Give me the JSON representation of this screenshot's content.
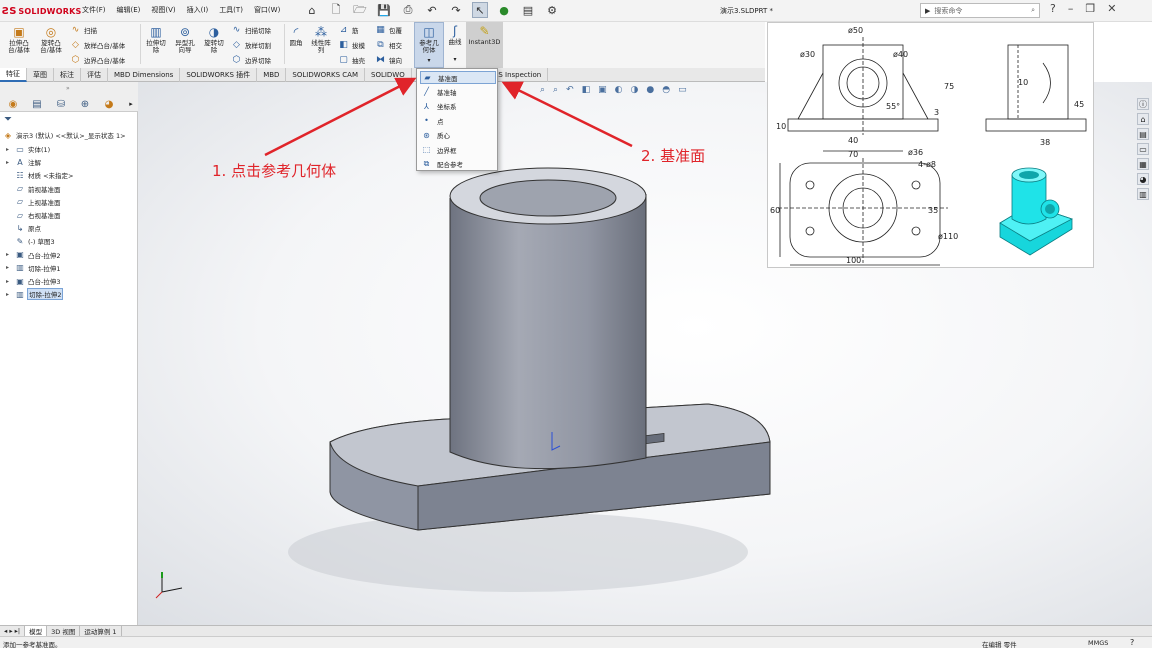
{
  "app": {
    "logo_text": "SOLIDWORKS",
    "document_title": "演示3.SLDPRT *"
  },
  "menu": [
    "文件(F)",
    "编辑(E)",
    "视图(V)",
    "插入(I)",
    "工具(T)",
    "窗口(W)"
  ],
  "search": {
    "placeholder": "搜索命令"
  },
  "ribbon": {
    "extrude_boss": "拉伸凸\n台/基体",
    "revolve_boss": "旋转凸\n台/基体",
    "sweep": "扫描",
    "loft_boss": "放样凸台/基体",
    "boundary_boss": "边界凸台/基体",
    "extrude_cut": "拉伸切\n除",
    "hole_wizard": "异型孔\n向导",
    "revolve_cut": "旋转切\n除",
    "swept_cut": "扫描切除",
    "lofted_cut": "放样切割",
    "boundary_cut": "边界切除",
    "fillet": "圆角",
    "linear_pattern": "线性阵\n列",
    "rib": "筋",
    "draft": "拔模",
    "shell": "抽壳",
    "wrap": "包覆",
    "intersect": "相交",
    "mirror": "镜向",
    "reference_geometry": "参考几\n何体",
    "curves": "曲线",
    "instant3d": "Instant3D"
  },
  "tabs": [
    "特征",
    "草图",
    "标注",
    "评估",
    "MBD Dimensions",
    "SOLIDWORKS 插件",
    "MBD",
    "SOLIDWORKS CAM",
    "SOLIDWO",
    "KS Inspection"
  ],
  "feature_tree": {
    "root": "演示3 (默认) <<默认>_显示状态 1>",
    "items": [
      {
        "label": "实体(1)",
        "icon": "folder-icon",
        "arrow": "▸"
      },
      {
        "label": "注解",
        "icon": "annotation-icon",
        "arrow": "▸"
      },
      {
        "label": "材质 <未指定>",
        "icon": "material-icon",
        "arrow": ""
      },
      {
        "label": "前视基准面",
        "icon": "plane-icon",
        "arrow": ""
      },
      {
        "label": "上视基准面",
        "icon": "plane-icon",
        "arrow": ""
      },
      {
        "label": "右视基准面",
        "icon": "plane-icon",
        "arrow": ""
      },
      {
        "label": "原点",
        "icon": "origin-icon",
        "arrow": ""
      },
      {
        "label": "(-) 草图3",
        "icon": "sketch-icon",
        "arrow": ""
      },
      {
        "label": "凸台-拉伸2",
        "icon": "boss-extrude-icon",
        "arrow": "▸"
      },
      {
        "label": "切除-拉伸1",
        "icon": "cut-extrude-icon",
        "arrow": "▸"
      },
      {
        "label": "凸台-拉伸3",
        "icon": "boss-extrude-icon",
        "arrow": "▸"
      },
      {
        "label": "切除-拉伸2",
        "icon": "cut-extrude-icon",
        "arrow": "▸"
      }
    ]
  },
  "dropdown": {
    "items": [
      {
        "label": "基准面",
        "icon": "plane-icon"
      },
      {
        "label": "基准轴",
        "icon": "axis-icon"
      },
      {
        "label": "坐标系",
        "icon": "coordinate-system-icon"
      },
      {
        "label": "点",
        "icon": "point-icon"
      },
      {
        "label": "质心",
        "icon": "center-of-mass-icon"
      },
      {
        "label": "边界框",
        "icon": "bounding-box-icon"
      },
      {
        "label": "配合参考",
        "icon": "mate-reference-icon"
      }
    ]
  },
  "annotations": {
    "step1": "1. 点击参考几何体",
    "step2": "2. 基准面"
  },
  "drawing": {
    "dims": [
      "ø50",
      "ø30",
      "ø40",
      "75",
      "3",
      "55°",
      "10",
      "40",
      "10",
      "45",
      "38",
      "70",
      "ø36",
      "4-ø8",
      "60",
      "35",
      "ø110",
      "100"
    ]
  },
  "bottom_tabs": [
    "模型",
    "3D 视图",
    "运动算例 1"
  ],
  "status": {
    "left": "添加一参考基准面。",
    "editing": "在编辑 零件",
    "units": "MMGS"
  },
  "colors": {
    "accent": "#2f6db5",
    "annotation": "#e0242a",
    "model_body": "#9aa0ad",
    "preview_model": "#1fe3e8"
  }
}
